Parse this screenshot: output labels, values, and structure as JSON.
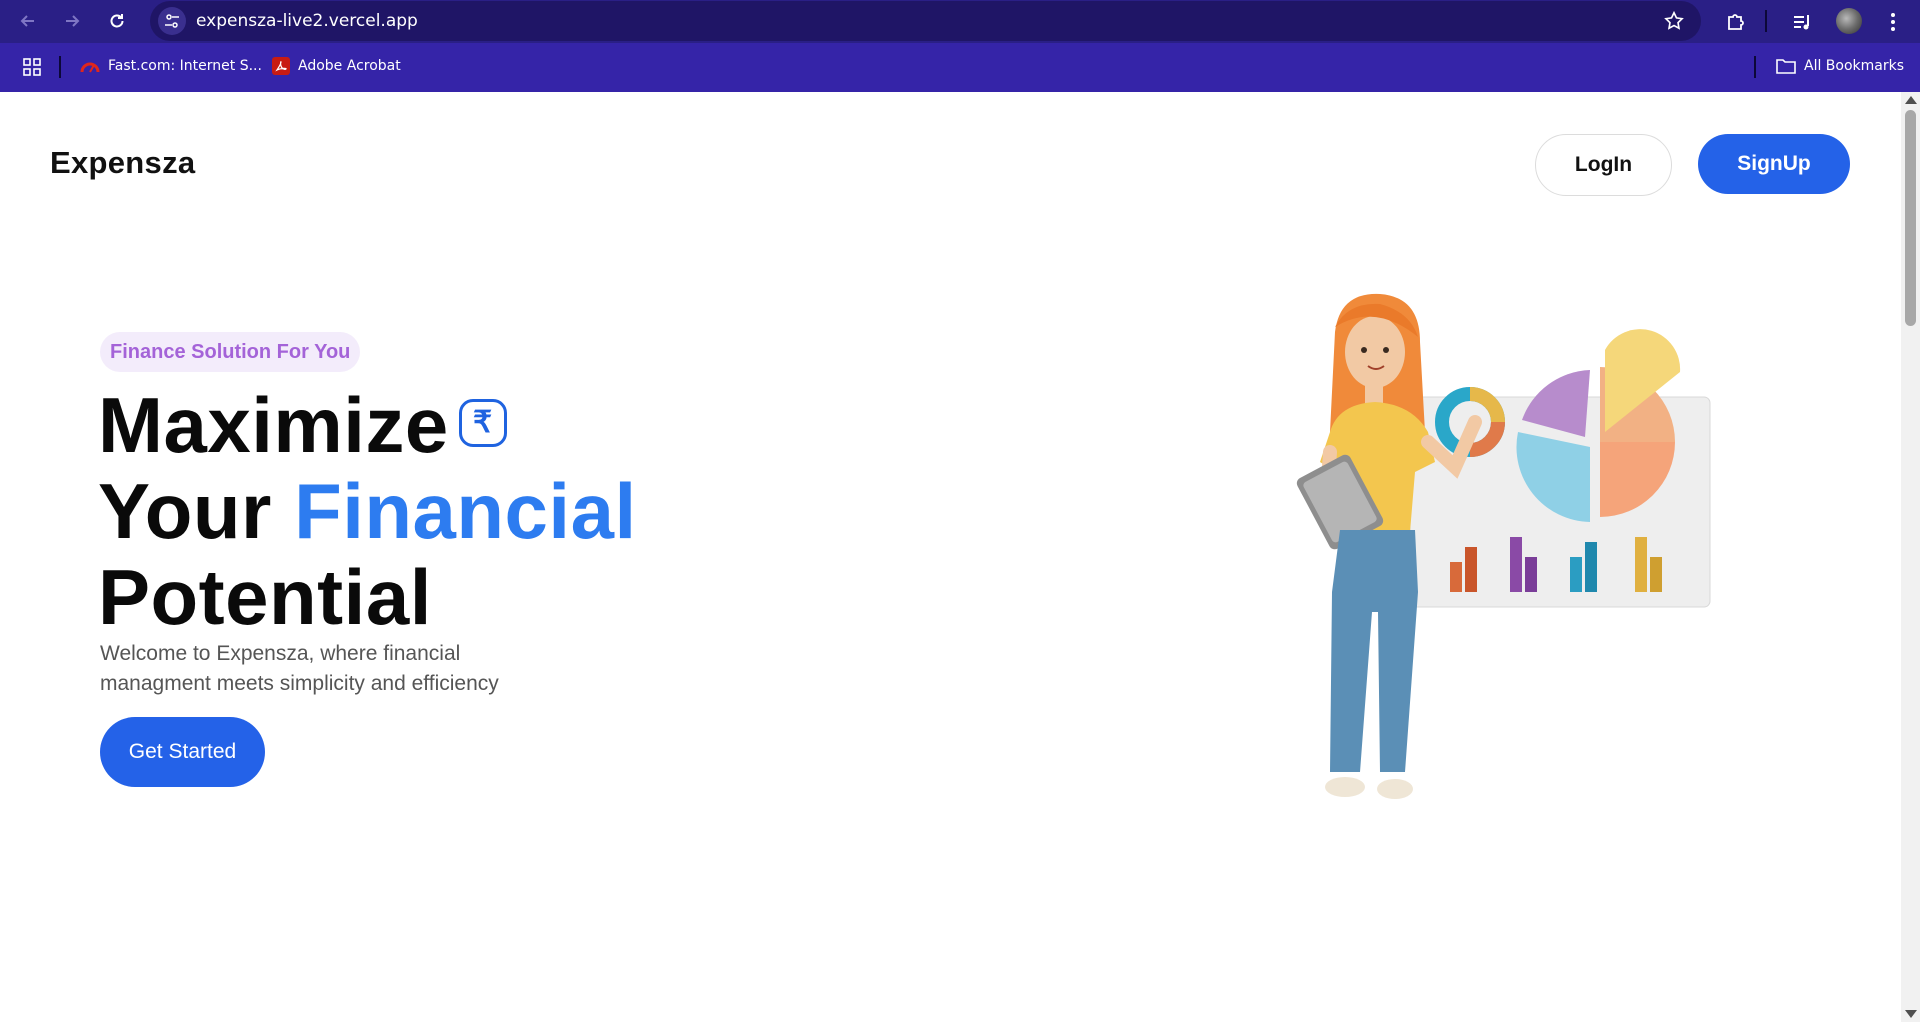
{
  "browser": {
    "url": "expensza-live2.vercel.app",
    "bookmarks": [
      {
        "label": "Fast.com: Internet S..."
      },
      {
        "label": "Adobe Acrobat"
      }
    ],
    "all_bookmarks_label": "All Bookmarks"
  },
  "header": {
    "logo": "Expensza",
    "login_label": "LogIn",
    "signup_label": "SignUp"
  },
  "hero": {
    "tagline": "Finance Solution For You",
    "headline_line1": "Maximize",
    "headline_line2_a": "Your ",
    "headline_line2_b": "Financial",
    "headline_line3": "Potential",
    "rupee_symbol": "₹",
    "subtext": "Welcome to Expensza, where financial managment meets simplicity and efficiency",
    "cta_label": "Get Started"
  },
  "colors": {
    "brand_blue": "#2462e8",
    "accent_blue": "#2d7cf0",
    "tagline_purple": "#a463d8",
    "chrome_bg": "#2a1f86"
  }
}
